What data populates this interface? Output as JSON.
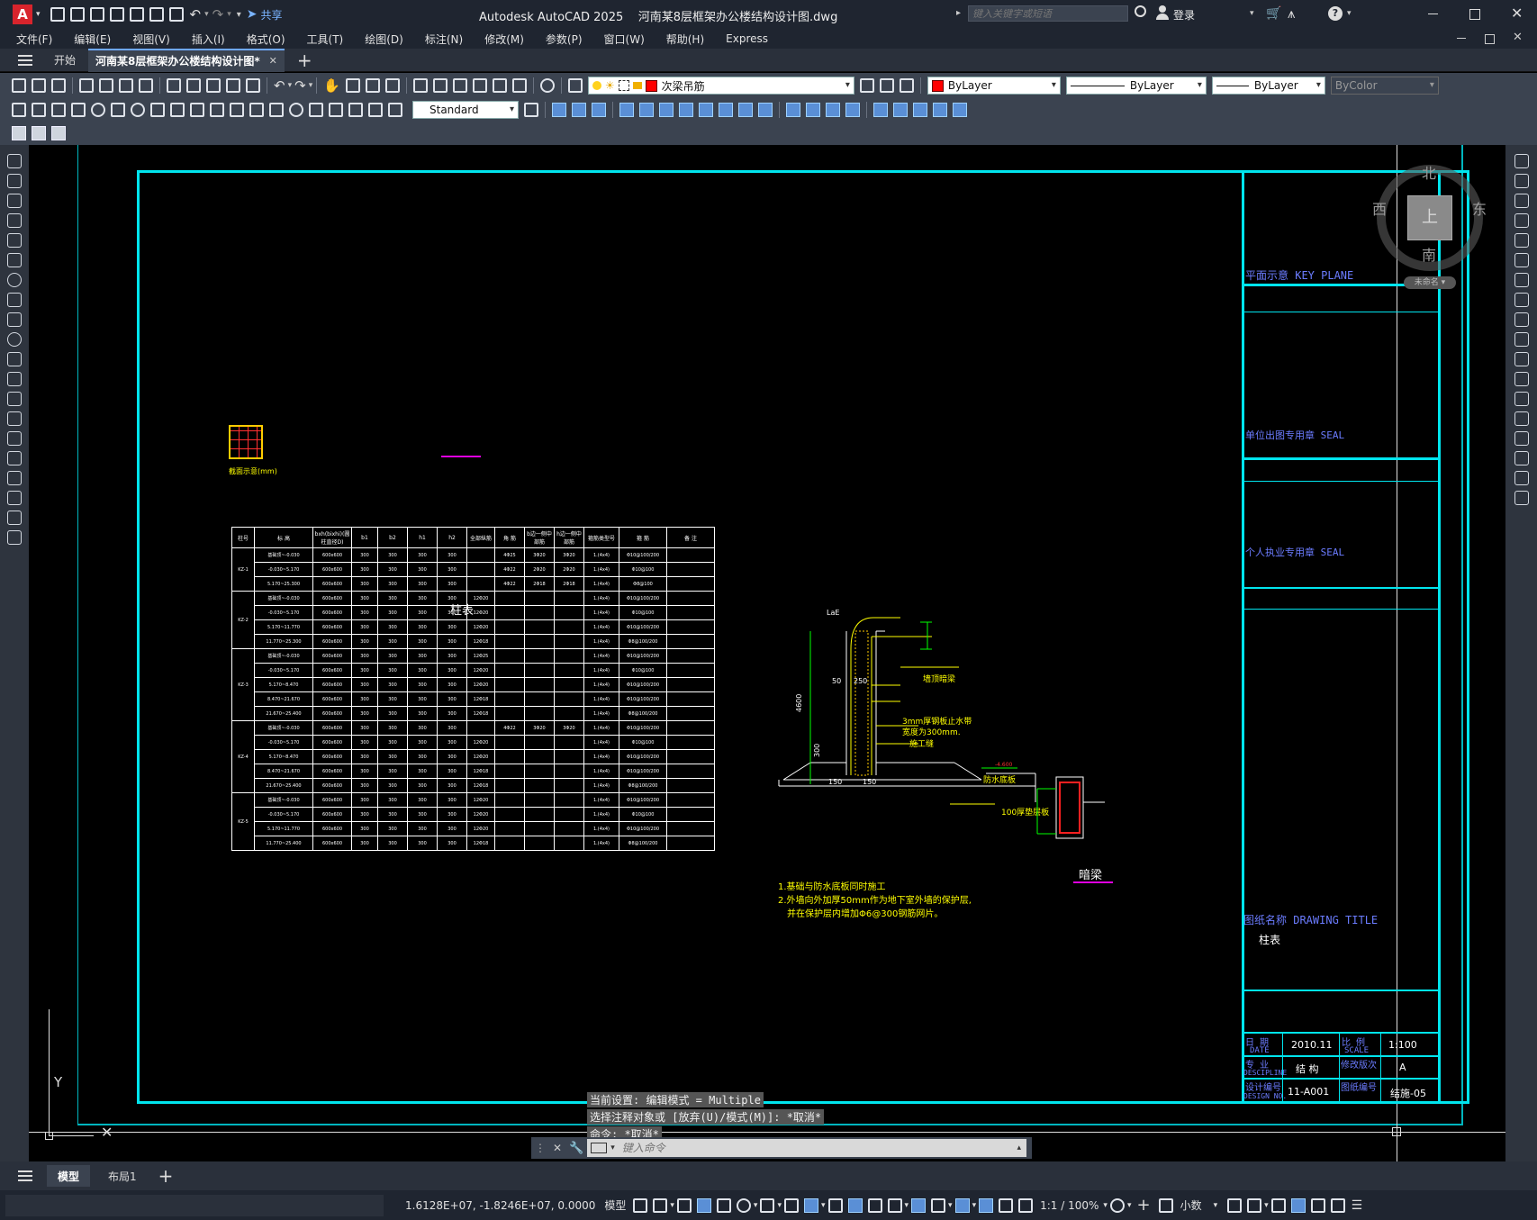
{
  "title_bar": {
    "app_title": "Autodesk AutoCAD 2025",
    "file_name": "河南某8层框架办公楼结构设计图.dwg",
    "share_label": "共享",
    "search_placeholder": "键入关键字或短语",
    "login_label": "登录"
  },
  "menu": [
    "文件(F)",
    "编辑(E)",
    "视图(V)",
    "插入(I)",
    "格式(O)",
    "工具(T)",
    "绘图(D)",
    "标注(N)",
    "修改(M)",
    "参数(P)",
    "窗口(W)",
    "帮助(H)",
    "Express"
  ],
  "tabs": {
    "start_label": "开始",
    "doc_label": "河南某8层框架办公楼结构设计图*"
  },
  "toolbar": {
    "layer_name": "次梁吊筋",
    "color_value": "ByLayer",
    "linetype_value": "ByLayer",
    "lineweight_value": "ByLayer",
    "plotstyle_value": "ByColor",
    "text_style": "Standard"
  },
  "viewcube": {
    "north": "北",
    "south": "南",
    "east": "东",
    "west": "西",
    "top": "上",
    "wcs": "未命名"
  },
  "ucs": {
    "y_label": "Y"
  },
  "title_block": {
    "key_plane": "平面示意 KEY PLANE",
    "seal_unit": "单位出图专用章 SEAL",
    "seal_personal": "个人执业专用章 SEAL",
    "drawing_title_label": "图纸名称 DRAWING TITLE",
    "drawing_title": "柱表",
    "date_label": "日  期",
    "date_label_en": "DATE",
    "date": "2010.11",
    "scale_label": "比  例",
    "scale_label_en": "SCALE",
    "scale": "1:100",
    "discipline_label": "专  业",
    "discipline_label_en": "DESCIPLINE",
    "discipline": "结 构",
    "revision_label": "修改版次",
    "revision": "A",
    "design_no_label": "设计编号",
    "design_no_label_en": "DESIGN NO.",
    "design_no": "11-A001",
    "drawing_no_label": "图纸编号",
    "drawing_no": "结施-05"
  },
  "drawing": {
    "table_caption": "柱表",
    "section_label": "截面示意(mm)",
    "beam_label": "暗梁",
    "notes": [
      "1.基础与防水底板同时施工",
      "2.外墙向外加厚50mm作为地下室外墙的保护层,",
      "并在保护层内增加Φ6@300钢筋网片。"
    ],
    "detail_labels": [
      "LaE",
      "4600",
      "300",
      "50",
      "250",
      "150",
      "150",
      "墙顶暗梁",
      "3mm厚钢板止水带",
      "宽度为300mm.",
      "施工缝",
      "防水底板",
      "100厚垫层板",
      "-4.600"
    ]
  },
  "column_table": {
    "headers": [
      "柱号",
      "标 高",
      "bxh(bixhi)(圆柱直径D)",
      "b1",
      "b2",
      "h1",
      "h2",
      "全部纵筋",
      "角 筋",
      "b边一侧中部筋",
      "h边一侧中部筋",
      "箍筋类型号",
      "箍 筋",
      "备 注"
    ],
    "groups": [
      {
        "id": "KZ-1",
        "rows": [
          [
            "基础顶~-0.030",
            "600x600",
            "300",
            "300",
            "300",
            "300",
            "",
            "4Φ25",
            "3Φ20",
            "3Φ20",
            "1.(4x4)",
            "Φ10@100/200",
            ""
          ],
          [
            "-0.030~5.170",
            "600x600",
            "300",
            "300",
            "300",
            "300",
            "",
            "4Φ22",
            "2Φ20",
            "2Φ20",
            "1.(4x4)",
            "Φ10@100",
            ""
          ],
          [
            "5.170~25.300",
            "600x600",
            "300",
            "300",
            "300",
            "300",
            "",
            "4Φ22",
            "2Φ18",
            "2Φ18",
            "1.(4x4)",
            "Φ8@100",
            ""
          ]
        ]
      },
      {
        "id": "KZ-2",
        "rows": [
          [
            "基础顶~-0.030",
            "600x600",
            "300",
            "300",
            "300",
            "300",
            "12Φ20",
            "",
            "",
            "",
            "1.(4x4)",
            "Φ10@100/200",
            ""
          ],
          [
            "-0.030~5.170",
            "600x600",
            "300",
            "300",
            "300",
            "300",
            "12Φ20",
            "",
            "",
            "",
            "1.(4x4)",
            "Φ10@100",
            ""
          ],
          [
            "5.170~11.770",
            "600x600",
            "300",
            "300",
            "300",
            "300",
            "12Φ20",
            "",
            "",
            "",
            "1.(4x4)",
            "Φ10@100/200",
            ""
          ],
          [
            "11.770~25.300",
            "600x600",
            "300",
            "300",
            "300",
            "300",
            "12Φ18",
            "",
            "",
            "",
            "1.(4x4)",
            "Φ8@100/200",
            ""
          ]
        ]
      },
      {
        "id": "KZ-3",
        "rows": [
          [
            "基础顶~-0.030",
            "600x600",
            "300",
            "300",
            "300",
            "300",
            "12Φ25",
            "",
            "",
            "",
            "1.(4x4)",
            "Φ10@100/200",
            ""
          ],
          [
            "-0.030~5.170",
            "600x600",
            "300",
            "300",
            "300",
            "300",
            "12Φ20",
            "",
            "",
            "",
            "1.(4x4)",
            "Φ10@100",
            ""
          ],
          [
            "5.170~8.470",
            "600x600",
            "300",
            "300",
            "300",
            "300",
            "12Φ20",
            "",
            "",
            "",
            "1.(4x4)",
            "Φ10@100/200",
            ""
          ],
          [
            "8.470~21.670",
            "600x600",
            "300",
            "300",
            "300",
            "300",
            "12Φ18",
            "",
            "",
            "",
            "1.(4x4)",
            "Φ10@100/200",
            ""
          ],
          [
            "21.670~25.400",
            "600x600",
            "300",
            "300",
            "300",
            "300",
            "12Φ18",
            "",
            "",
            "",
            "1.(4x4)",
            "Φ8@100/200",
            ""
          ]
        ]
      },
      {
        "id": "KZ-4",
        "rows": [
          [
            "基础顶~-0.030",
            "600x600",
            "300",
            "300",
            "300",
            "300",
            "",
            "4Φ22",
            "3Φ20",
            "3Φ20",
            "1.(4x4)",
            "Φ10@100/200",
            ""
          ],
          [
            "-0.030~5.170",
            "600x600",
            "300",
            "300",
            "300",
            "300",
            "12Φ20",
            "",
            "",
            "",
            "1.(4x4)",
            "Φ10@100",
            ""
          ],
          [
            "5.170~8.470",
            "600x600",
            "300",
            "300",
            "300",
            "300",
            "12Φ20",
            "",
            "",
            "",
            "1.(4x4)",
            "Φ10@100/200",
            ""
          ],
          [
            "8.470~21.670",
            "600x600",
            "300",
            "300",
            "300",
            "300",
            "12Φ18",
            "",
            "",
            "",
            "1.(4x4)",
            "Φ10@100/200",
            ""
          ],
          [
            "21.670~25.400",
            "600x600",
            "300",
            "300",
            "300",
            "300",
            "12Φ18",
            "",
            "",
            "",
            "1.(4x4)",
            "Φ8@100/200",
            ""
          ]
        ]
      },
      {
        "id": "KZ-5",
        "rows": [
          [
            "基础顶~-0.030",
            "600x600",
            "300",
            "300",
            "300",
            "300",
            "12Φ20",
            "",
            "",
            "",
            "1.(4x4)",
            "Φ10@100/200",
            ""
          ],
          [
            "-0.030~5.170",
            "600x600",
            "300",
            "300",
            "300",
            "300",
            "12Φ20",
            "",
            "",
            "",
            "1.(4x4)",
            "Φ10@100",
            ""
          ],
          [
            "5.170~11.770",
            "600x600",
            "300",
            "300",
            "300",
            "300",
            "12Φ20",
            "",
            "",
            "",
            "1.(4x4)",
            "Φ10@100/200",
            ""
          ],
          [
            "11.770~25.400",
            "600x600",
            "300",
            "300",
            "300",
            "300",
            "12Φ18",
            "",
            "",
            "",
            "1.(4x4)",
            "Φ8@100/200",
            ""
          ]
        ]
      }
    ]
  },
  "command": {
    "history": [
      "当前设置: 编辑模式 = Multiple",
      "选择注释对象或 [放弃(U)/模式(M)]: *取消*",
      "命令: *取消*"
    ],
    "placeholder": "键入命令"
  },
  "layout_tabs": {
    "model": "模型",
    "layout1": "布局1"
  },
  "status": {
    "coords": "1.6128E+07, -1.8246E+07, 0.0000",
    "model_label": "模型",
    "scale": "1:1 / 100%",
    "units": "小数"
  }
}
